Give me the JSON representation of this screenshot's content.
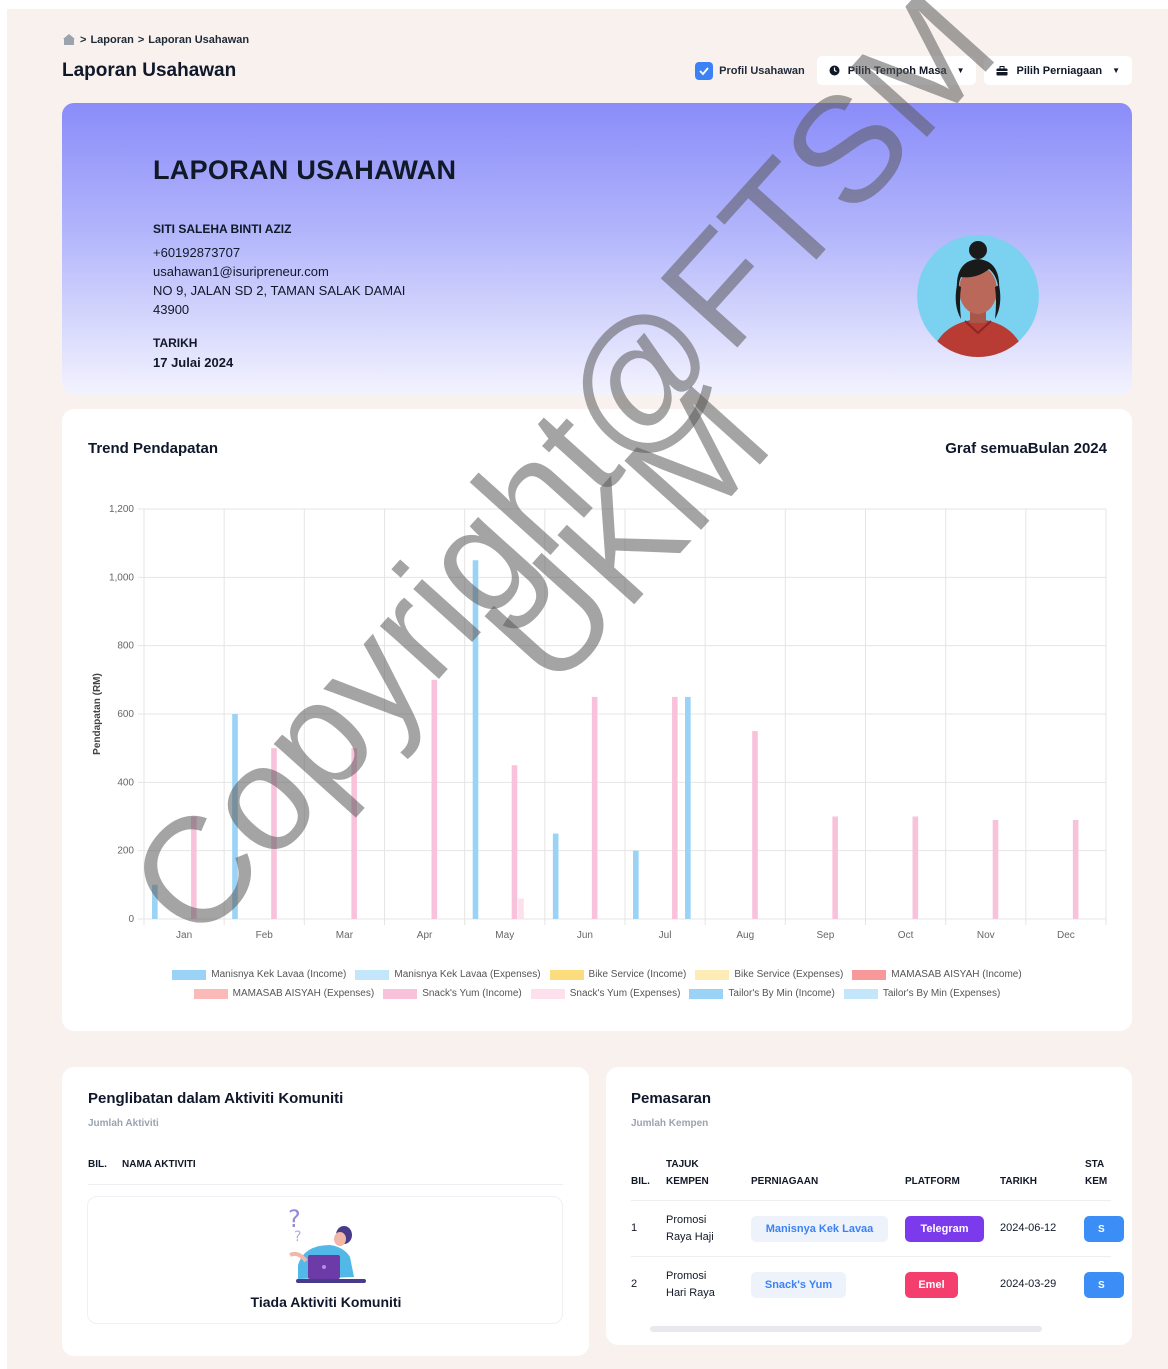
{
  "breadcrumb": {
    "items": [
      "Laporan",
      "Laporan Usahawan"
    ],
    "separator": ">"
  },
  "page_title": "Laporan Usahawan",
  "toolbar": {
    "profile_checkbox_label": "Profil Usahawan",
    "profile_checked": true,
    "period_button": "Pilih Tempoh Masa",
    "business_button": "Pilih Perniagaan"
  },
  "hero": {
    "title": "LAPORAN USAHAWAN",
    "name": "SITI SALEHA BINTI AZIZ",
    "phone": "+60192873707",
    "email": "usahawan1@isuripreneur.com",
    "address": "NO 9, JALAN SD 2, TAMAN SALAK DAMAI",
    "postcode": "43900",
    "date_label": "TARIKH",
    "date": "17 Julai 2024"
  },
  "trend": {
    "title": "Trend Pendapatan",
    "subtitle": "Graf semuaBulan 2024"
  },
  "chart_data": {
    "type": "bar",
    "categories": [
      "Jan",
      "Feb",
      "Mar",
      "Apr",
      "May",
      "Jun",
      "Jul",
      "Aug",
      "Sep",
      "Oct",
      "Nov",
      "Dec"
    ],
    "ylabel": "Pendapatan (RM)",
    "ylim": [
      0,
      1200
    ],
    "yticks": [
      "0",
      "200",
      "400",
      "600",
      "800",
      "1,000",
      "1,200"
    ],
    "grid": true,
    "legend_position": "bottom",
    "series": [
      {
        "name": "Manisnya Kek Lavaa (Income)",
        "color": "#9ad3f5",
        "values": [
          100,
          600,
          0,
          0,
          1050,
          250,
          200,
          0,
          0,
          0,
          0,
          0
        ]
      },
      {
        "name": "Manisnya Kek Lavaa (Expenses)",
        "color": "#c4e6fb",
        "values": [
          0,
          0,
          0,
          0,
          0,
          0,
          0,
          0,
          0,
          0,
          0,
          0
        ]
      },
      {
        "name": "Bike Service  (Income)",
        "color": "#fddc7e",
        "values": [
          0,
          0,
          0,
          0,
          0,
          0,
          0,
          0,
          0,
          0,
          0,
          0
        ]
      },
      {
        "name": "Bike Service  (Expenses)",
        "color": "#feecb6",
        "values": [
          0,
          0,
          0,
          0,
          0,
          0,
          0,
          0,
          0,
          0,
          0,
          0
        ]
      },
      {
        "name": "MAMASAB AISYAH (Income)",
        "color": "#f7989a",
        "values": [
          0,
          0,
          0,
          0,
          0,
          0,
          0,
          0,
          0,
          0,
          0,
          0
        ]
      },
      {
        "name": "MAMASAB AISYAH (Expenses)",
        "color": "#fbb9b7",
        "values": [
          0,
          0,
          0,
          0,
          0,
          0,
          0,
          0,
          0,
          0,
          0,
          0
        ]
      },
      {
        "name": "Snack's Yum  (Income)",
        "color": "#f9c2db",
        "values": [
          300,
          500,
          500,
          700,
          450,
          650,
          650,
          550,
          300,
          300,
          290,
          290
        ]
      },
      {
        "name": "Snack's Yum  (Expenses)",
        "color": "#fde0ec",
        "values": [
          0,
          0,
          0,
          0,
          60,
          0,
          0,
          0,
          0,
          0,
          0,
          0
        ]
      },
      {
        "name": "Tailor's By Min (Income)",
        "color": "#9ad3f5",
        "values": [
          0,
          0,
          0,
          0,
          0,
          0,
          650,
          0,
          0,
          0,
          0,
          0
        ]
      },
      {
        "name": "Tailor's By Min (Expenses)",
        "color": "#c4e6fb",
        "values": [
          0,
          0,
          0,
          0,
          0,
          0,
          0,
          0,
          0,
          0,
          0,
          0
        ]
      }
    ]
  },
  "community": {
    "title": "Penglibatan dalam Aktiviti Komuniti",
    "subtitle": "Jumlah Aktiviti",
    "headers": [
      "BIL.",
      "NAMA AKTIVITI"
    ],
    "empty_text": "Tiada Aktiviti Komuniti"
  },
  "marketing": {
    "title": "Pemasaran",
    "subtitle": "Jumlah Kempen",
    "headers": {
      "bil": "BIL.",
      "tajuk_1": "TAJUK",
      "tajuk_2": "KEMPEN",
      "perniagaan": "PERNIAGAAN",
      "platform": "PLATFORM",
      "tarikh": "TARIKH",
      "status_1": "STA",
      "status_2": "KEM"
    },
    "rows": [
      {
        "bil": "1",
        "title_1": "Promosi",
        "title_2": "Raya Haji",
        "business": "Manisnya Kek Lavaa",
        "platform": "Telegram",
        "platform_color": "#7c3aed",
        "date": "2024-06-12",
        "status": "S"
      },
      {
        "bil": "2",
        "title_1": "Promosi",
        "title_2": "Hari Raya",
        "business": "Snack's Yum",
        "platform": "Emel",
        "platform_color": "#f43f6e",
        "date": "2024-03-29",
        "status": "S"
      }
    ]
  },
  "watermark": {
    "line1": "Copyright@FTSM",
    "line2": "UKM"
  },
  "colors": {
    "accent": "#3b82f6",
    "hero_top": "#8a8cf9",
    "page_bg": "#f8f1ee"
  }
}
